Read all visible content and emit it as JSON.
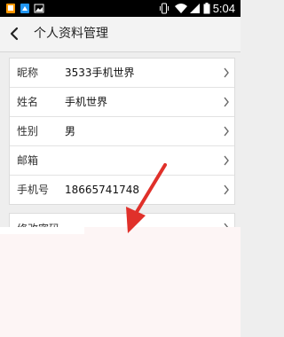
{
  "status_bar": {
    "time": "5:04",
    "icons": [
      "phone-icon",
      "app-icon",
      "image-icon",
      "vibrate-icon",
      "wifi-icon",
      "signal-icon",
      "battery-icon"
    ]
  },
  "header": {
    "title": "个人资料管理",
    "back_icon": "back-arrow-icon"
  },
  "profile": {
    "rows": [
      {
        "label": "昵称",
        "value": "3533手机世界"
      },
      {
        "label": "姓名",
        "value": "手机世界"
      },
      {
        "label": "性别",
        "value": "男"
      },
      {
        "label": "邮箱",
        "value": ""
      },
      {
        "label": "手机号",
        "value": "18665741748"
      }
    ]
  },
  "security": {
    "change_password_label": "修改密码"
  },
  "colors": {
    "status_bar": "#000000",
    "title_bar": "#f3f3f3",
    "background": "#eeeeee",
    "annotation_arrow": "#e0302a",
    "overlay": "#fdf5f5"
  }
}
